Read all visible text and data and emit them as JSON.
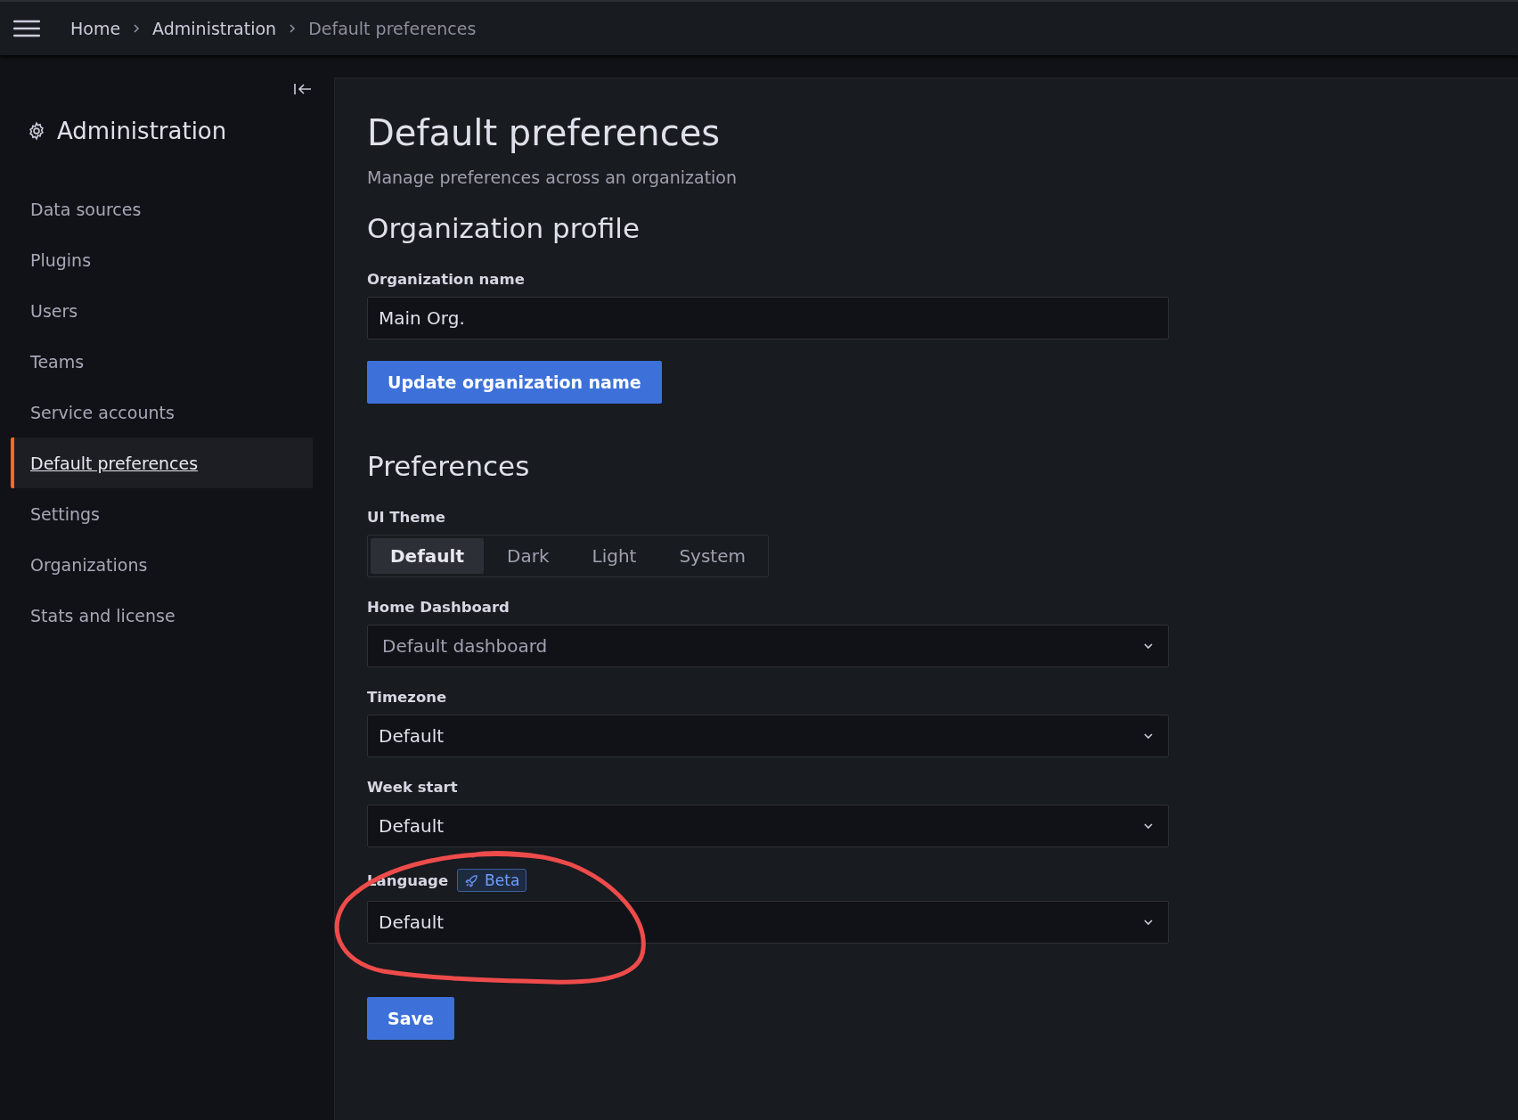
{
  "breadcrumbs": [
    {
      "label": "Home",
      "current": false
    },
    {
      "label": "Administration",
      "current": false
    },
    {
      "label": "Default preferences",
      "current": true
    }
  ],
  "sidebar": {
    "title": "Administration",
    "items": [
      {
        "label": "Data sources",
        "selected": false
      },
      {
        "label": "Plugins",
        "selected": false
      },
      {
        "label": "Users",
        "selected": false
      },
      {
        "label": "Teams",
        "selected": false
      },
      {
        "label": "Service accounts",
        "selected": false
      },
      {
        "label": "Default preferences",
        "selected": true
      },
      {
        "label": "Settings",
        "selected": false
      },
      {
        "label": "Organizations",
        "selected": false
      },
      {
        "label": "Stats and license",
        "selected": false
      }
    ]
  },
  "page": {
    "title": "Default preferences",
    "subtitle": "Manage preferences across an organization"
  },
  "organization_profile": {
    "heading": "Organization profile",
    "name_label": "Organization name",
    "name_value": "Main Org.",
    "button": "Update organization name"
  },
  "preferences": {
    "heading": "Preferences",
    "theme_label": "UI Theme",
    "theme_options": [
      {
        "label": "Default",
        "selected": true
      },
      {
        "label": "Dark",
        "selected": false
      },
      {
        "label": "Light",
        "selected": false
      },
      {
        "label": "System",
        "selected": false
      }
    ],
    "selects": [
      {
        "label": "Home Dashboard",
        "placeholder": "Default dashboard"
      },
      {
        "label": "Timezone",
        "value": "Default"
      },
      {
        "label": "Week start",
        "value": "Default"
      },
      {
        "label": "Language",
        "badge": "Beta",
        "value": "Default"
      }
    ],
    "save_button": "Save"
  }
}
